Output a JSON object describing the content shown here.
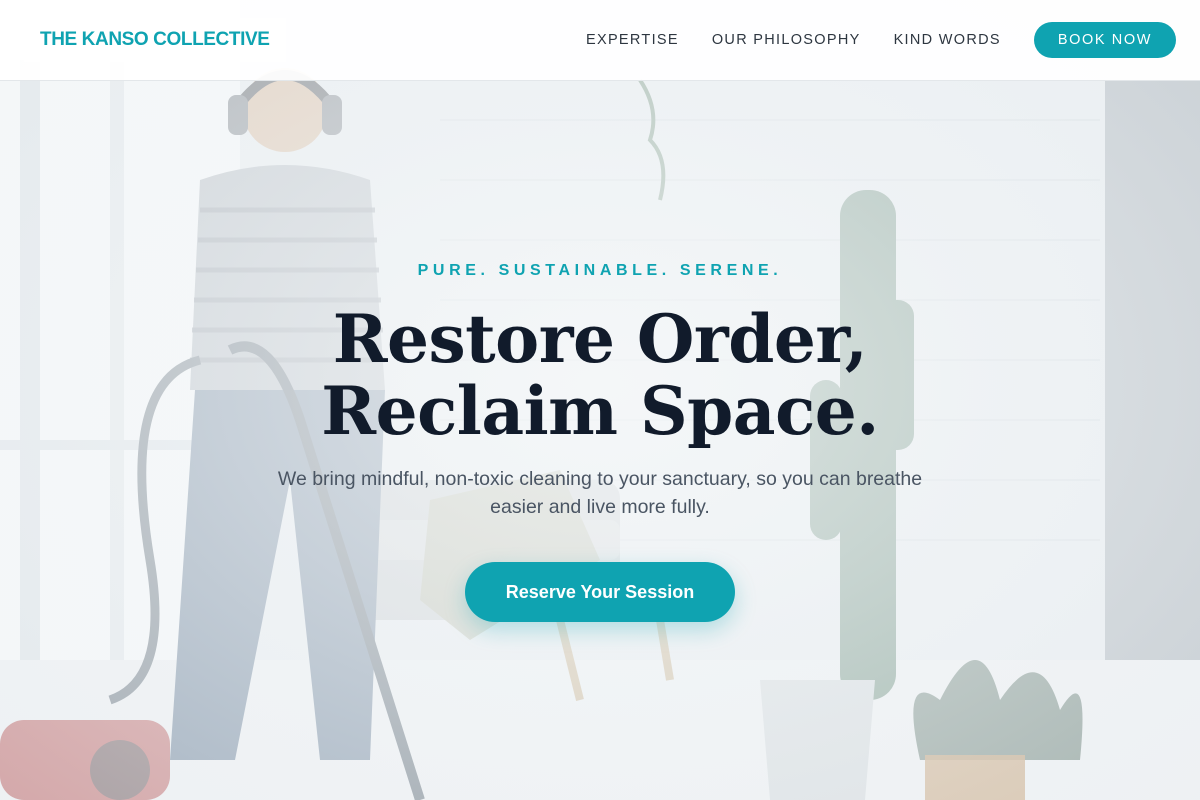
{
  "header": {
    "logo": "THE KANSO COLLECTIVE",
    "nav": [
      {
        "label": "EXPERTISE"
      },
      {
        "label": "OUR PHILOSOPHY"
      },
      {
        "label": "KIND WORDS"
      }
    ],
    "book_button": "BOOK NOW"
  },
  "hero": {
    "tagline": "PURE. SUSTAINABLE. SERENE.",
    "headline_line1": "Restore Order,",
    "headline_line2": "Reclaim Space.",
    "subtext": "We bring mindful, non-toxic cleaning to your sanctuary, so you can breathe easier and live more fully.",
    "cta_label": "Reserve Your Session"
  },
  "colors": {
    "accent": "#0fa3b1",
    "headline": "#111b2b",
    "body_text": "#4a5563",
    "nav_text": "#2d3640"
  },
  "background_image": "woman-vacuuming-living-room-photo"
}
